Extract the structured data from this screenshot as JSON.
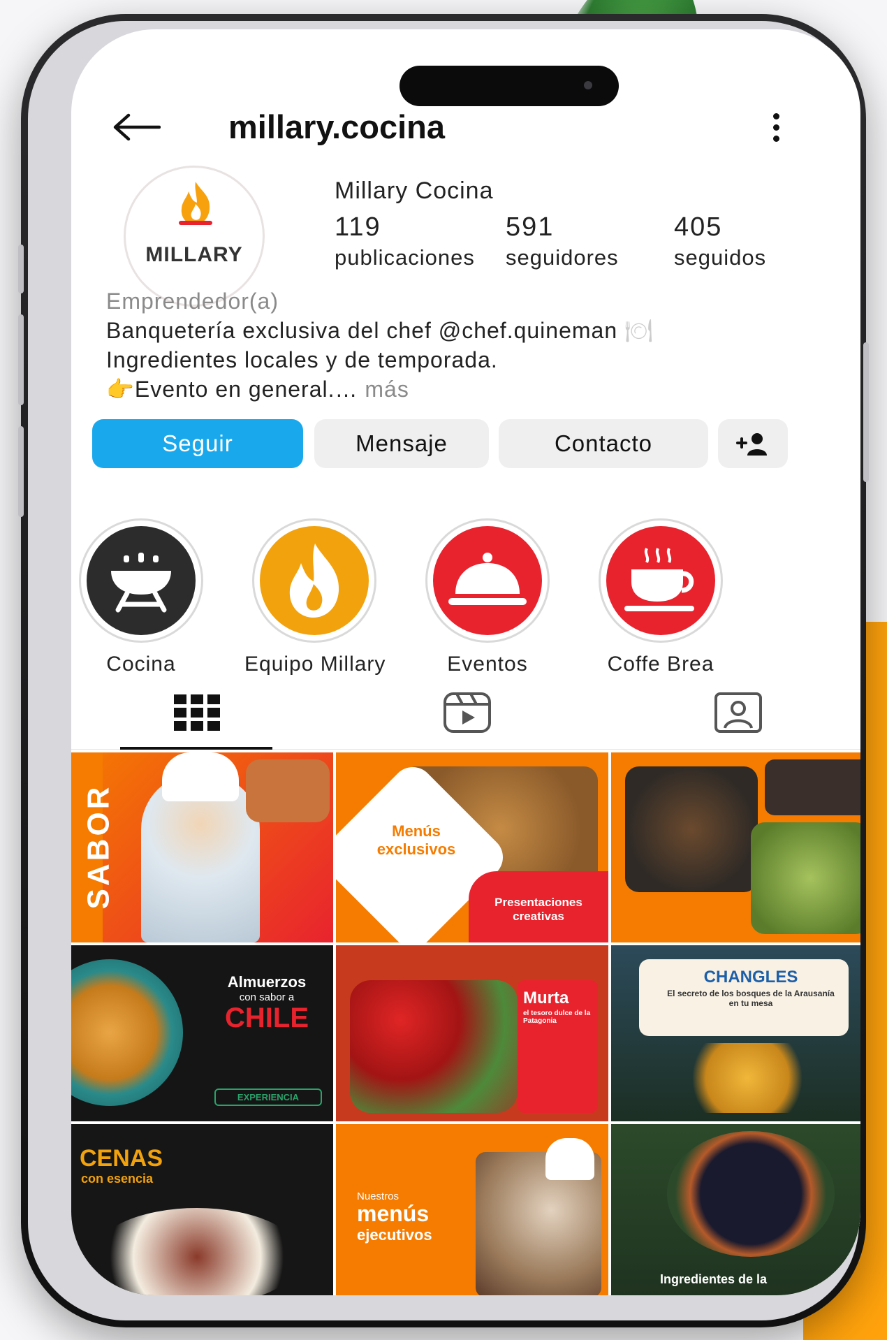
{
  "profile": {
    "username": "millary.cocina",
    "display_name": "Millary Cocina",
    "avatar_text": "MILLARY",
    "stats": [
      {
        "value": "119",
        "label": "publicaciones"
      },
      {
        "value": "591",
        "label": "seguidores"
      },
      {
        "value": "405",
        "label": "seguidos"
      }
    ],
    "category": "Emprendedor(a)",
    "bio_line1": "Banquetería exclusiva del chef @chef.quineman",
    "bio_line2": "Ingredientes locales y de temporada.",
    "bio_line3_icon": "👉",
    "bio_line3": "Evento en general.…",
    "bio_more": " más"
  },
  "actions": {
    "follow": "Seguir",
    "message": "Mensaje",
    "contact": "Contacto",
    "add_person_icon": "add-person-icon"
  },
  "highlights": [
    {
      "label": "Cocina",
      "color": "#2c2c2c",
      "icon": "grill-icon"
    },
    {
      "label": "Equipo Millary",
      "color": "#f2a20c",
      "icon": "flame-icon"
    },
    {
      "label": "Eventos",
      "color": "#e8232e",
      "icon": "cloche-icon"
    },
    {
      "label": "Coffe Brea",
      "color": "#e8232e",
      "icon": "coffee-cup-icon"
    }
  ],
  "tabs": [
    {
      "name": "grid-icon",
      "active": true
    },
    {
      "name": "reels-icon",
      "active": false
    },
    {
      "name": "tagged-icon",
      "active": false
    }
  ],
  "posts": [
    {
      "id": "post-1",
      "title": "SABOR"
    },
    {
      "id": "post-2",
      "title": "Menús exclusivos",
      "subtitle": "Presentaciones creativas"
    },
    {
      "id": "post-3",
      "title": ""
    },
    {
      "id": "post-4",
      "title": "Almuerzos",
      "subtitle": "con sabor a",
      "highlight": "CHILE",
      "tag": "EXPERIENCIA"
    },
    {
      "id": "post-5",
      "title": "Murta",
      "subtitle": "el tesoro dulce de la Patagonia"
    },
    {
      "id": "post-6",
      "title": "CHANGLES",
      "subtitle": "El secreto de los bosques de la Arausanía en tu mesa"
    },
    {
      "id": "post-7",
      "title": "CENAS",
      "subtitle": "con esencia"
    },
    {
      "id": "post-8",
      "title": "menús",
      "pre": "Nuestros",
      "subtitle": "ejecutivos"
    },
    {
      "id": "post-9",
      "title": "Ingredientes de la"
    }
  ],
  "colors": {
    "follow_blue": "#1aa8ec",
    "brand_orange": "#f57c00",
    "accent_red": "#e8232e"
  }
}
